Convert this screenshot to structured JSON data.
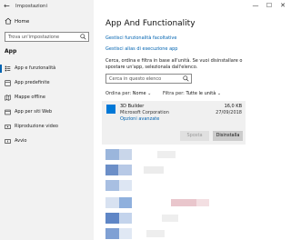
{
  "window": {
    "title": "Impostazioni",
    "back_glyph": "←",
    "minimize_glyph": "—",
    "maximize_glyph": "☐",
    "close_glyph": "✕"
  },
  "sidebar": {
    "home_label": "Home",
    "search_placeholder": "Trova un'impostazione",
    "section_label": "App",
    "items": [
      {
        "label": "App e funzionalità",
        "icon": "apps-list-icon",
        "selected": true
      },
      {
        "label": "App predefinite",
        "icon": "default-apps-icon"
      },
      {
        "label": "Mappe offline",
        "icon": "offline-maps-icon"
      },
      {
        "label": "App per siti Web",
        "icon": "apps-for-websites-icon"
      },
      {
        "label": "Riproduzione video",
        "icon": "video-playback-icon"
      },
      {
        "label": "Avvio",
        "icon": "startup-icon"
      }
    ]
  },
  "main": {
    "title": "App And Functionality",
    "link_optional": "Gestisci funzionalità facoltative",
    "link_aliases": "Gestisci alias di esecuzione app",
    "description_lines": [
      "Cerca, ordina e filtra in base all'unità. Se vuoi disinstallare o",
      "spostare un'app, selezionala dall'elenco."
    ],
    "list_search_placeholder": "Cerca in questo elenco",
    "sort_label": "Ordina per:",
    "sort_value": "Nome",
    "filter_label": "Filtra per:",
    "filter_value": "Tutte le unità",
    "dropdown_glyph": "⌄",
    "selected_app": {
      "name": "3D Builder",
      "publisher": "Microsoft Corporation",
      "advanced_link": "Opzioni avanzate",
      "size": "16,0 KB",
      "date": "27/09/2018",
      "move_button": "Sposta",
      "uninstall_button": "Disinstalla"
    }
  },
  "colors": {
    "accent": "#0063b1",
    "tile_blue": "#0078d7",
    "sidebar_bg": "#f2f2f2",
    "selected_card_bg": "#f0f0f0"
  }
}
